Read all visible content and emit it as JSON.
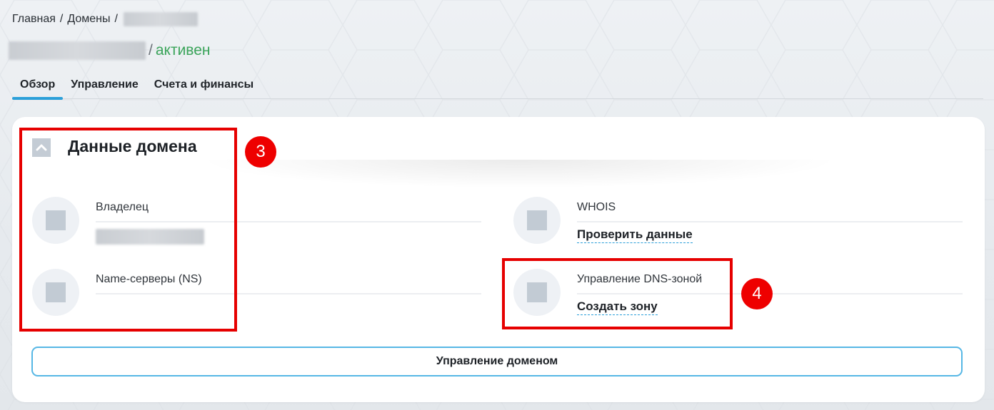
{
  "breadcrumb": {
    "home": "Главная",
    "domains": "Домены",
    "separator": "/"
  },
  "title": {
    "separator": "/",
    "status": "активен"
  },
  "tabs": [
    {
      "label": "Обзор",
      "active": true
    },
    {
      "label": "Управление",
      "active": false
    },
    {
      "label": "Счета и финансы",
      "active": false
    }
  ],
  "section": {
    "title": "Данные домена"
  },
  "items": {
    "owner": {
      "label": "Владелец"
    },
    "ns": {
      "label": "Name-серверы (NS)"
    },
    "whois": {
      "label": "WHOIS",
      "link": "Проверить данные"
    },
    "dns": {
      "label": "Управление DNS-зоной",
      "link": "Создать зону"
    }
  },
  "manage_button": {
    "label": "Управление доменом"
  },
  "annotations": [
    {
      "number": "3"
    },
    {
      "number": "4"
    }
  ],
  "colors": {
    "accent": "#2b9fd9",
    "status_green": "#3aa45a",
    "annotation_red": "#e60000"
  },
  "icons": {
    "collapse": "chevron-up-icon",
    "item_placeholder": "square-icon"
  }
}
